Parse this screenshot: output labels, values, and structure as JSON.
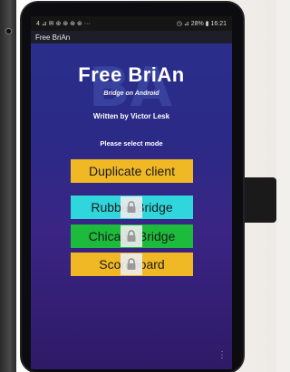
{
  "status_bar": {
    "left": "4 ⊿ ✉ ⊛ ⊛ ⊛ ⊛ ···",
    "right": "◷ ⊿ 28% ▮ 16:21"
  },
  "title_bar": {
    "title": "Free BriAn"
  },
  "header": {
    "title": "Free BriAn",
    "subtitle": "Bridge on Android",
    "author": "Written by Victor Lesk",
    "watermark": "BA"
  },
  "mode_select": {
    "prompt": "Please select mode",
    "buttons": [
      {
        "label": "Duplicate client",
        "color": "#f0b825",
        "locked": false
      },
      {
        "label": "Rubber Bridge",
        "color": "#2fd6dc",
        "locked": true
      },
      {
        "label": "Chicago Bridge",
        "color": "#1dbb3c",
        "locked": true
      },
      {
        "label": "Scoreboard",
        "color": "#f0b825",
        "locked": true
      }
    ]
  },
  "icons": {
    "lock": "lock-icon",
    "menu": "more-vertical-icon"
  }
}
